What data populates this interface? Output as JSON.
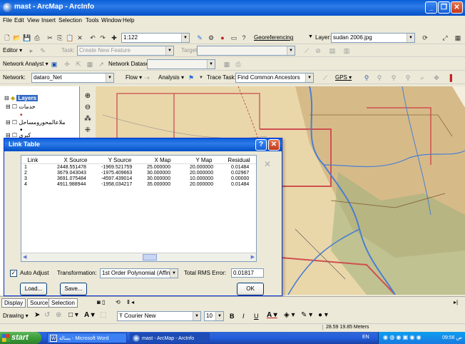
{
  "window": {
    "title": "mast - ArcMap - ArcInfo"
  },
  "menu": [
    "File",
    "Edit",
    "View",
    "Insert",
    "Selection",
    "Tools",
    "Window",
    "Help"
  ],
  "standard_toolbar": {
    "scale": "1:122",
    "georeferencing_label": "Georeferencing",
    "layer_label": "Layer:",
    "layer_value": "sudan 2006.jpg"
  },
  "editor_toolbar": {
    "editor_label": "Editor",
    "task_label": "Task:",
    "task_value": "Create New Feature",
    "target_label": "Target:"
  },
  "network_analyst_toolbar": {
    "label": "Network Analyst",
    "dataset_label": "Network Dataset"
  },
  "utility_toolbar": {
    "network_label": "Network:",
    "network_value": "dataro_Net",
    "flow_label": "Flow",
    "analysis_label": "Analysis",
    "trace_task_label": "Trace Task:",
    "trace_task_value": "Find Common Ancestors",
    "gps_label": "GPS"
  },
  "toc": {
    "root": "Layers",
    "items": [
      "خدمات",
      "ملاعالمحورومساحل",
      "كبرى"
    ]
  },
  "link_table": {
    "title": "Link Table",
    "columns": [
      "Link",
      "X Source",
      "Y Source",
      "X Map",
      "Y Map",
      "Residual"
    ],
    "rows": [
      [
        "1",
        "2448.551478",
        "-1969.521759",
        "25.000000",
        "20.000000",
        "0.01484"
      ],
      [
        "2",
        "3679.043043",
        "-1975.409663",
        "30.000000",
        "20.000000",
        "0.02967"
      ],
      [
        "3",
        "3691.075484",
        "-4597.439014",
        "30.000000",
        "10.000000",
        "0.00000"
      ],
      [
        "4",
        "4911.988944",
        "-1958.034217",
        "35.000000",
        "20.000000",
        "0.01484"
      ]
    ],
    "auto_adjust_label": "Auto Adjust",
    "auto_adjust_checked": true,
    "transformation_label": "Transformation:",
    "transformation_value": "1st Order Polynomial (Affine)",
    "rms_label": "Total RMS Error:",
    "rms_value": "0.01817",
    "load_label": "Load...",
    "save_label": "Save...",
    "ok_label": "OK"
  },
  "tabs": [
    "Display",
    "Source",
    "Selection"
  ],
  "drawing_toolbar": {
    "drawing_label": "Drawing",
    "font_value": "Courier New",
    "font_size": "10",
    "bold": "B",
    "italic": "I",
    "underline": "U"
  },
  "status": {
    "coords": "28.59  19.85 Meters"
  },
  "taskbar": {
    "start_label": "start",
    "tasks": [
      "يسالة - Microsoft Word",
      "mast - ArcMap - ArcInfo"
    ],
    "lang": "EN",
    "clock": "09:56 ص"
  },
  "colors": {
    "title_blue": "#0A5FD8",
    "start_green": "#3C9D3A",
    "map_base": "#E9D7AA",
    "rivers": "#4A7FD0",
    "borders": "#D05050"
  }
}
